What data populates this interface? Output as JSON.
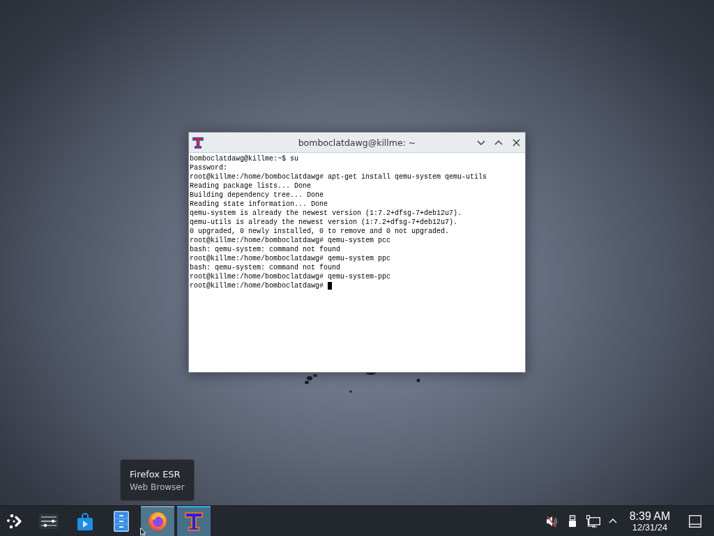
{
  "window": {
    "title": "bomboclatdawg@killme: ~",
    "lines": [
      "bomboclatdawg@killme:~$ su",
      "Password:",
      "root@killme:/home/bomboclatdawg# apt-get install qemu-system qemu-utils",
      "Reading package lists... Done",
      "Building dependency tree... Done",
      "Reading state information... Done",
      "qemu-system is already the newest version (1:7.2+dfsg-7+deb12u7).",
      "qemu-utils is already the newest version (1:7.2+dfsg-7+deb12u7).",
      "0 upgraded, 0 newly installed, 0 to remove and 0 not upgraded.",
      "root@killme:/home/bomboclatdawg# qemu-system pcc",
      "bash: qemu-system: command not found",
      "root@killme:/home/bomboclatdawg# qemu-system ppc",
      "bash: qemu-system: command not found",
      "root@killme:/home/bomboclatdawg# qemu-system-ppc",
      "root@killme:/home/bomboclatdawg#"
    ],
    "cursor": true
  },
  "tooltip": {
    "title": "Firefox ESR",
    "subtitle": "Web Browser"
  },
  "taskbar": {
    "items": [
      {
        "kind": "launcher",
        "hovered": false,
        "active": false
      },
      {
        "kind": "settings",
        "hovered": false,
        "active": false
      },
      {
        "kind": "store",
        "hovered": false,
        "active": false
      },
      {
        "kind": "files",
        "hovered": false,
        "active": false
      },
      {
        "kind": "browser",
        "hovered": true,
        "active": false
      },
      {
        "kind": "terminal",
        "hovered": false,
        "active": true
      }
    ],
    "volume": {
      "muted": true
    },
    "tray_icons": [
      {
        "kind": "usb"
      },
      {
        "kind": "network"
      },
      {
        "kind": "expand"
      }
    ],
    "clock": {
      "time": "8:39 AM",
      "date": "12/31/24"
    }
  }
}
